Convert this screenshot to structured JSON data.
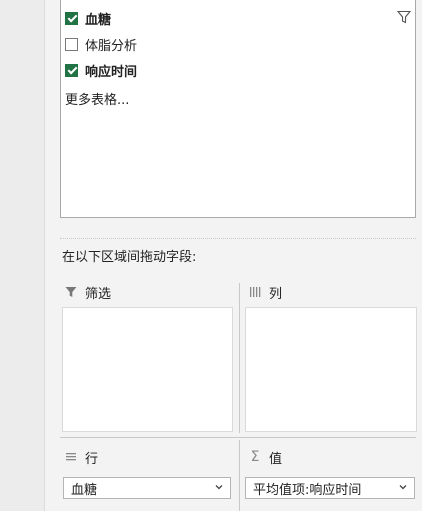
{
  "fields": [
    {
      "label": "血糖",
      "checked": true,
      "bold": true
    },
    {
      "label": "体脂分析",
      "checked": false,
      "bold": false
    },
    {
      "label": "响应时间",
      "checked": true,
      "bold": true
    }
  ],
  "more_tables": "更多表格...",
  "drag_caption": "在以下区域间拖动字段:",
  "areas": {
    "filters": {
      "label": "筛选",
      "icon": "filter-icon"
    },
    "columns": {
      "label": "列",
      "icon": "columns-icon"
    },
    "rows": {
      "label": "行",
      "icon": "rows-icon",
      "item": "血糖"
    },
    "values": {
      "label": "值",
      "icon": "sigma-icon",
      "item": "平均值项:响应时间"
    }
  },
  "colors": {
    "check": "#217346",
    "panel": "#f3f3f3"
  }
}
